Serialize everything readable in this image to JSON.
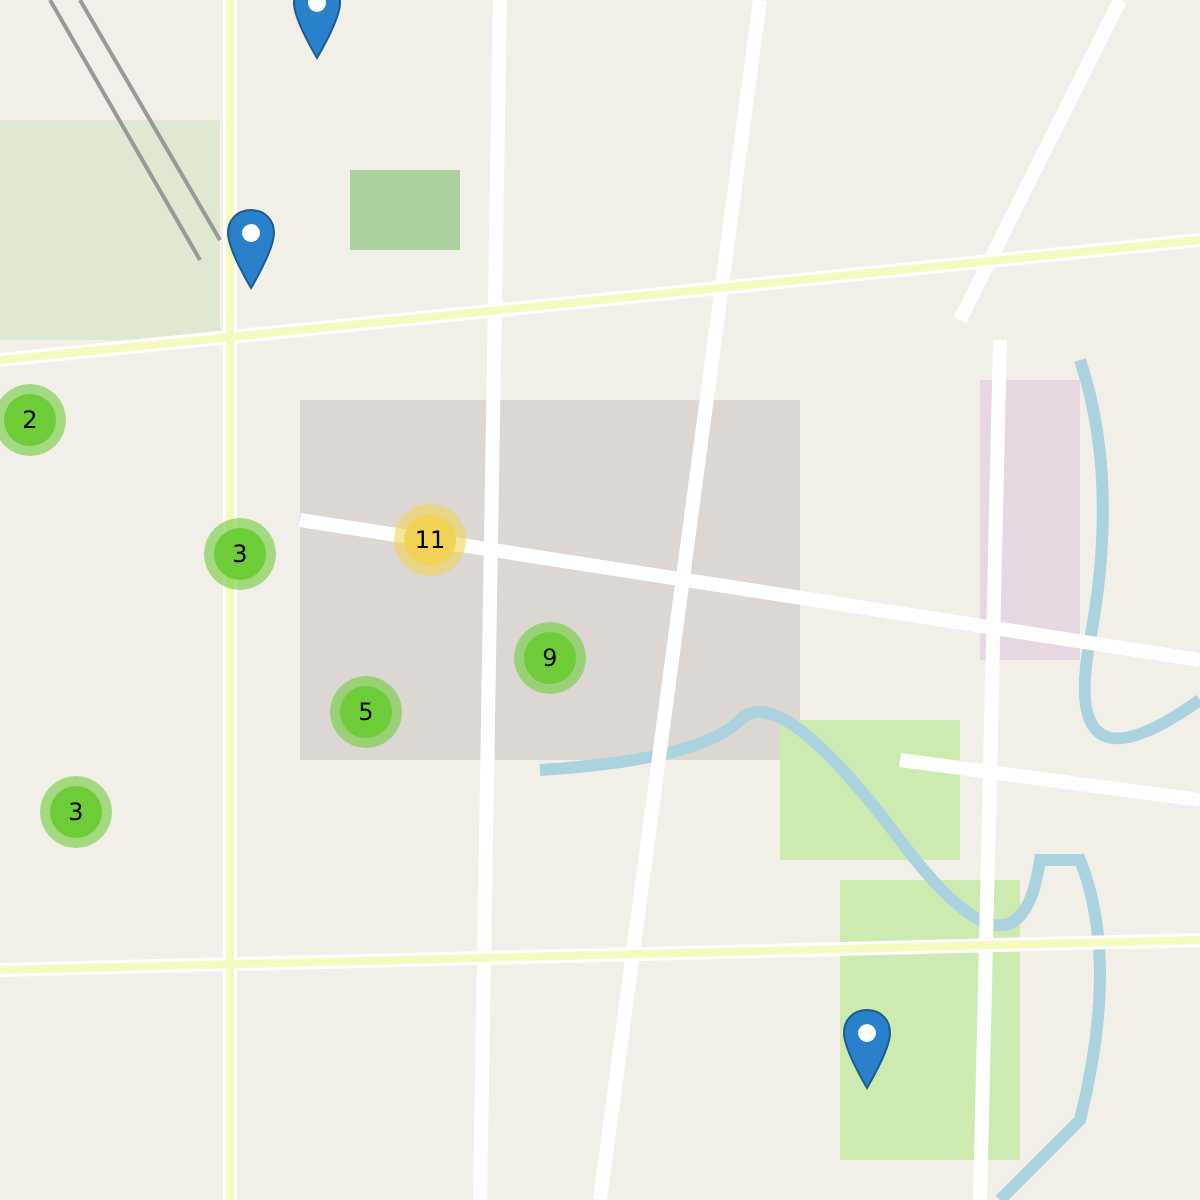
{
  "map": {
    "clusters": [
      {
        "count": "2",
        "color": "#6ecc39"
      },
      {
        "count": "3",
        "color": "#6ecc39"
      },
      {
        "count": "11",
        "color": "#f1d357"
      },
      {
        "count": "5",
        "color": "#6ecc39"
      },
      {
        "count": "9",
        "color": "#6ecc39"
      },
      {
        "count": "3",
        "color": "#6ecc39"
      }
    ],
    "pins": [
      {
        "kind": "location"
      },
      {
        "kind": "location"
      },
      {
        "kind": "location"
      }
    ]
  }
}
